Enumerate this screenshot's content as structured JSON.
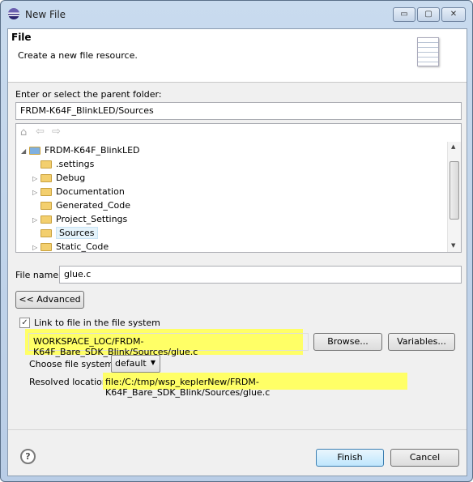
{
  "window": {
    "title": "New File",
    "minimize": "▭",
    "maximize": "▢",
    "close": "✕"
  },
  "header": {
    "title": "File",
    "description": "Create a new file resource."
  },
  "parent": {
    "label": "Enter or select the parent folder:",
    "value": "FRDM-K64F_BlinkLED/Sources"
  },
  "tree": {
    "items": [
      {
        "label": "FRDM-K64F_BlinkLED",
        "level": 0,
        "expander": "◢"
      },
      {
        "label": ".settings",
        "level": 1,
        "expander": ""
      },
      {
        "label": "Debug",
        "level": 1,
        "expander": "▷"
      },
      {
        "label": "Documentation",
        "level": 1,
        "expander": "▷"
      },
      {
        "label": "Generated_Code",
        "level": 1,
        "expander": ""
      },
      {
        "label": "Project_Settings",
        "level": 1,
        "expander": "▷"
      },
      {
        "label": "Sources",
        "level": 1,
        "expander": "",
        "selected": true
      },
      {
        "label": "Static_Code",
        "level": 1,
        "expander": "▷"
      }
    ]
  },
  "filename": {
    "label": "File name:",
    "value": "glue.c"
  },
  "advanced_button": "<< Advanced",
  "link": {
    "label": "Link to file in the file system",
    "checked": true,
    "value": "WORKSPACE_LOC/FRDM-K64F_Bare_SDK_Blink/Sources/glue.c",
    "browse": "Browse...",
    "variables": "Variables..."
  },
  "filesystem": {
    "label": "Choose file system:",
    "value": "default"
  },
  "resolved": {
    "label": "Resolved location:",
    "value": "file:/C:/tmp/wsp_keplerNew/FRDM-K64F_Bare_SDK_Blink/Sources/glue.c"
  },
  "footer": {
    "help": "?",
    "finish": "Finish",
    "cancel": "Cancel"
  },
  "colors": {
    "highlight": "#ffff66",
    "selection": "#e5f3fb"
  }
}
